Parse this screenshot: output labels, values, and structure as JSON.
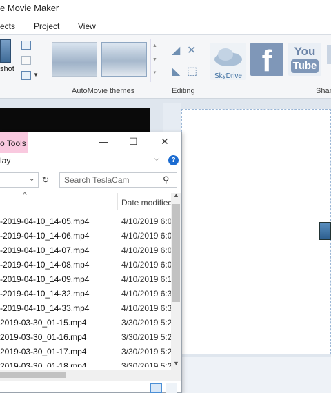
{
  "window": {
    "title": "e Movie Maker"
  },
  "menu_tabs": [
    "ects",
    "Project",
    "View"
  ],
  "ribbon": {
    "snapshot_label": "shot",
    "automovie_themes_label": "AutoMovie themes",
    "editing_label": "Editing",
    "share_label": "Shar",
    "skydrive_label": "SkyDrive",
    "facebook_glyph": "f",
    "youtube_line1": "You",
    "youtube_line2": "Tube"
  },
  "explorer": {
    "context_tab": "o Tools",
    "play_tab": "lay",
    "minimize": "—",
    "maximize": "☐",
    "close": "✕",
    "help": "?",
    "search_placeholder": "Search TeslaCam",
    "column_date": "Date modified",
    "files": [
      {
        "name": "-2019-04-10_14-05.mp4",
        "date": "4/10/2019 6:0"
      },
      {
        "name": "-2019-04-10_14-06.mp4",
        "date": "4/10/2019 6:0"
      },
      {
        "name": "-2019-04-10_14-07.mp4",
        "date": "4/10/2019 6:0"
      },
      {
        "name": "-2019-04-10_14-08.mp4",
        "date": "4/10/2019 6:0"
      },
      {
        "name": "-2019-04-10_14-09.mp4",
        "date": "4/10/2019 6:1"
      },
      {
        "name": "-2019-04-10_14-32.mp4",
        "date": "4/10/2019 6:3"
      },
      {
        "name": "-2019-04-10_14-33.mp4",
        "date": "4/10/2019 6:3"
      },
      {
        "name": "2019-03-30_01-15.mp4",
        "date": "3/30/2019 5:2"
      },
      {
        "name": "2019-03-30_01-16.mp4",
        "date": "3/30/2019 5:2"
      },
      {
        "name": "2019-03-30_01-17.mp4",
        "date": "3/30/2019 5:2"
      },
      {
        "name": "2019-03-30_01-18.mp4",
        "date": "3/30/2019 5:2"
      }
    ]
  },
  "colors": {
    "accent": "#1c6cd1",
    "context_tab": "#f9c9df",
    "preview": "#0a0a0a"
  }
}
